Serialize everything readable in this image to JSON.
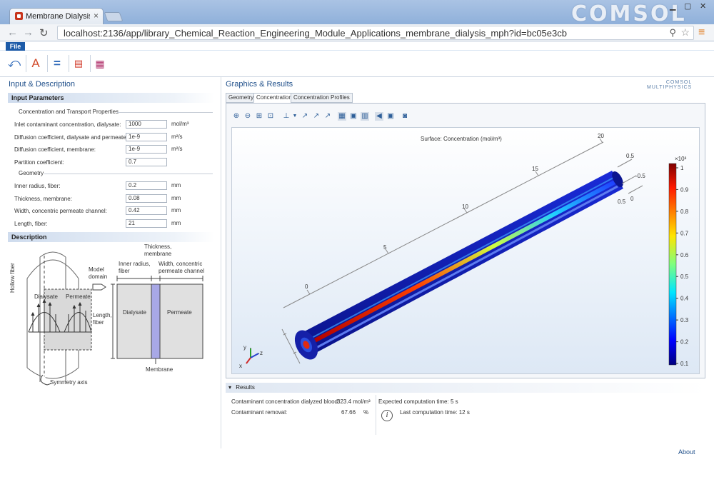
{
  "browser": {
    "tab_title": "Membrane Dialysis | COMS",
    "brand": "COMSOL",
    "url": "localhost:2136/app/library_Chemical_Reaction_Engineering_Module_Applications_membrane_dialysis_mph?id=bc05e3cb"
  },
  "menu": {
    "file": "File"
  },
  "left": {
    "title": "Input & Description",
    "input_header": "Input Parameters",
    "conc_title": "Concentration and Transport Properties",
    "params": [
      {
        "label": "Inlet contaminant concentration, dialysate:",
        "value": "1000",
        "unit": "mol/m³"
      },
      {
        "label": "Diffusion coefficient, dialysate and permeate:",
        "value": "1e-9",
        "unit": "m²/s"
      },
      {
        "label": "Diffusion coefficient, membrane:",
        "value": "1e-9",
        "unit": "m²/s"
      },
      {
        "label": "Partition coefficient:",
        "value": "0.7",
        "unit": ""
      }
    ],
    "geom_title": "Geometry",
    "geom": [
      {
        "label": "Inner radius, fiber:",
        "value": "0.2",
        "unit": "mm"
      },
      {
        "label": "Thickness, membrane:",
        "value": "0.08",
        "unit": "mm"
      },
      {
        "label": "Width, concentric permeate channel:",
        "value": "0.42",
        "unit": "mm"
      },
      {
        "label": "Length, fiber:",
        "value": "21",
        "unit": "mm"
      }
    ],
    "desc_header": "Description",
    "diagram": {
      "hollow_fiber": "Hollow fiber",
      "dialysate": "Dialysate",
      "permeate": "Permeate",
      "model_domain_1": "Model",
      "model_domain_2": "domain",
      "length_1": "Length,",
      "length_2": "fiber",
      "symmetry": "Symmetry axis",
      "thickness_1": "Thickness,",
      "thickness_2": "membrane",
      "inner_1": "Inner radius,",
      "inner_2": "fiber",
      "width_1": "Width, concentric",
      "width_2": "permeate channel",
      "box_dialysate": "Dialysate",
      "box_permeate": "Permeate",
      "membrane": "Membrane"
    }
  },
  "right": {
    "title": "Graphics & Results",
    "logo_1": "COMSOL",
    "logo_2": "MULTIPHYSICS",
    "tabs": [
      "Geometry",
      "Concentration",
      "Concentration Profiles"
    ],
    "plot": {
      "title": "Surface: Concentration (mol/m³)",
      "axis_ticks": [
        "0",
        "5",
        "10",
        "15",
        "20"
      ],
      "end_ticks": [
        "0.5",
        "-0.5",
        "0",
        "0.5"
      ],
      "triad": {
        "x": "x",
        "y": "y",
        "z": "z"
      },
      "colorbar": {
        "multiplier": "×10³",
        "ticks": [
          "1",
          "0.9",
          "0.8",
          "0.7",
          "0.6",
          "0.5",
          "0.4",
          "0.3",
          "0.2",
          "0.1"
        ]
      }
    },
    "results_header": "Results",
    "results": {
      "conc_label": "Contaminant concentration dialyzed blood:",
      "conc_value": "323.4 mol/m³",
      "removal_label": "Contaminant removal:",
      "removal_value": "67.66",
      "removal_unit": "%",
      "expected": "Expected computation time:  5 s",
      "last": "Last computation time: 12 s"
    }
  },
  "footer": {
    "about": "About"
  },
  "colors": {
    "accent": "#1f4f8a",
    "file_button": "#1d5ba8"
  }
}
